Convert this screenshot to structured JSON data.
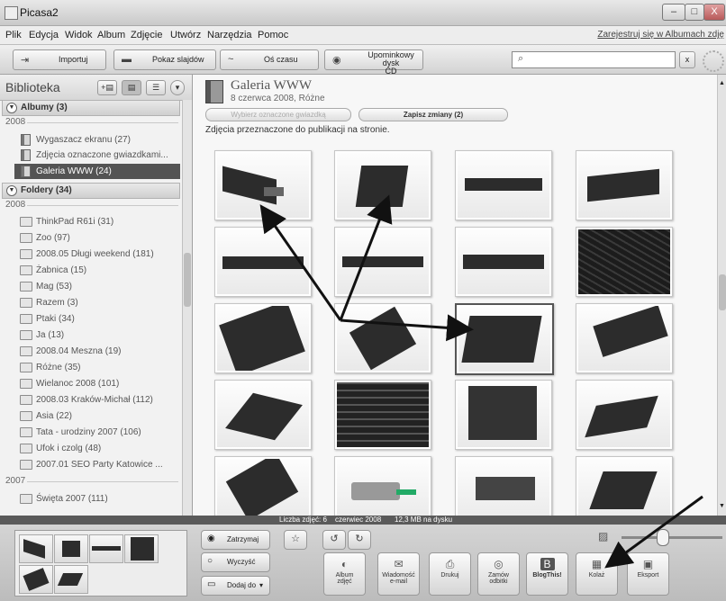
{
  "window": {
    "title": "Picasa2",
    "min": "–",
    "max": "□",
    "close": "X"
  },
  "menu": {
    "items": [
      "Plik",
      "Edycja",
      "Widok",
      "Album",
      "Zdjęcie",
      "Utwórz",
      "Narzędzia",
      "Pomoc"
    ],
    "register_link": "Zarejestruj się w Albumach zdję"
  },
  "toolbar": {
    "import": "Importuj",
    "slideshow": "Pokaz slajdów",
    "timeline": "Oś czasu",
    "gift_cd_line1": "Upominkowy dysk",
    "gift_cd_line2": "CD",
    "search_placeholder": "",
    "search_clear": "x"
  },
  "library": {
    "title": "Biblioteka",
    "albums_header": "Albumy (3)",
    "albums_year": "2008",
    "albums": [
      "Wygaszacz ekranu (27)",
      "Zdjęcia oznaczone gwiazdkami...",
      "Galeria WWW (24)"
    ],
    "folders_header": "Foldery (34)",
    "folders_year": "2008",
    "folders": [
      "ThinkPad R61i (31)",
      "Zoo (97)",
      "2008.05 Długi weekend (181)",
      "Żabnica (15)",
      "Mag (53)",
      "Razem (3)",
      "Ptaki (34)",
      "Ja (13)",
      "2008.04 Meszna (19)",
      "Różne (35)",
      "Wielanoc 2008 (101)",
      "2008.03 Kraków-Michał (112)",
      "Asia (22)",
      "Tata - urodziny 2007 (106)",
      "Ufok i czolg (48)",
      "2007.01 SEO Party Katowice ..."
    ],
    "year_2007": "2007",
    "folders_2007": [
      "Święta 2007 (111)"
    ]
  },
  "album": {
    "title": "Galeria WWW",
    "subtitle": "8 czerwca 2008, Różne",
    "btn_select": "Wybierz oznaczone gwiazdką",
    "btn_save": "Zapisz zmiany (2)",
    "caption": "Zdjęcia przeznaczone do publikacji na stronie."
  },
  "status": {
    "count": "Liczba zdjęć: 6",
    "date": "czerwiec 2008",
    "size": "12,3 MB na dysku"
  },
  "tray": {
    "hold": "Zatrzymaj",
    "clear": "Wyczyść",
    "add_to": "Dodaj do",
    "actions": [
      {
        "icon": "album-icon",
        "l1": "Album",
        "l2": "zdjęć"
      },
      {
        "icon": "email-icon",
        "l1": "Wiadomość",
        "l2": "e-mail"
      },
      {
        "icon": "print-icon",
        "l1": "Drukuj",
        "l2": ""
      },
      {
        "icon": "order-prints-icon",
        "l1": "Zamów",
        "l2": "odbitki"
      },
      {
        "icon": "blog-icon",
        "l1": "BlogThis!",
        "l2": ""
      },
      {
        "icon": "collage-icon",
        "l1": "Kolaż",
        "l2": ""
      },
      {
        "icon": "export-icon",
        "l1": "Eksport",
        "l2": ""
      }
    ]
  }
}
